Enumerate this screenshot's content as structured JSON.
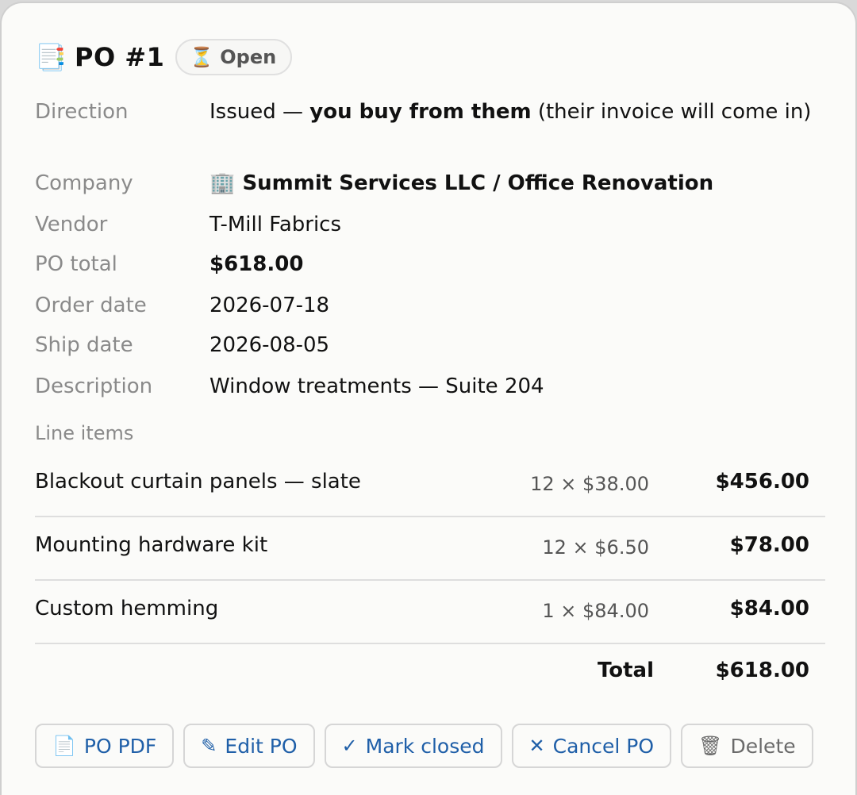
{
  "header": {
    "icon": "📑",
    "title": "PO #1",
    "status": {
      "icon": "⏳",
      "label": "Open"
    }
  },
  "fields": {
    "direction": {
      "label": "Direction",
      "prefix": "Issued — ",
      "emphasis": "you buy from them",
      "suffix": " (their invoice will come in)"
    },
    "company": {
      "label": "Company",
      "icon": "🏢",
      "value": "Summit Services LLC / Office Renovation"
    },
    "vendor": {
      "label": "Vendor",
      "value": "T-Mill Fabrics"
    },
    "po_total": {
      "label": "PO total",
      "value": "$618.00"
    },
    "order_date": {
      "label": "Order date",
      "value": "2026-07-18"
    },
    "ship_date": {
      "label": "Ship date",
      "value": "2026-08-05"
    },
    "description": {
      "label": "Description",
      "value": "Window treatments — Suite 204"
    }
  },
  "line_items": {
    "label": "Line items",
    "items": [
      {
        "name": "Blackout curtain panels — slate",
        "qty": "12 × $38.00",
        "amount": "$456.00"
      },
      {
        "name": "Mounting hardware kit",
        "qty": "12 × $6.50",
        "amount": "$78.00"
      },
      {
        "name": "Custom hemming",
        "qty": "1 × $84.00",
        "amount": "$84.00"
      }
    ],
    "total_label": "Total",
    "total_value": "$618.00"
  },
  "actions": {
    "pdf": {
      "icon": "📄",
      "label": "PO PDF"
    },
    "edit": {
      "icon": "✎",
      "label": "Edit PO"
    },
    "close": {
      "icon": "✓",
      "label": "Mark closed"
    },
    "cancel": {
      "icon": "✕",
      "label": "Cancel PO"
    },
    "delete": {
      "icon": "🗑",
      "label": "Delete"
    }
  },
  "colors": {
    "link_blue": "#1f5fa8",
    "label_grey": "#8a8a8a",
    "card_bg": "#fbfbf9"
  }
}
